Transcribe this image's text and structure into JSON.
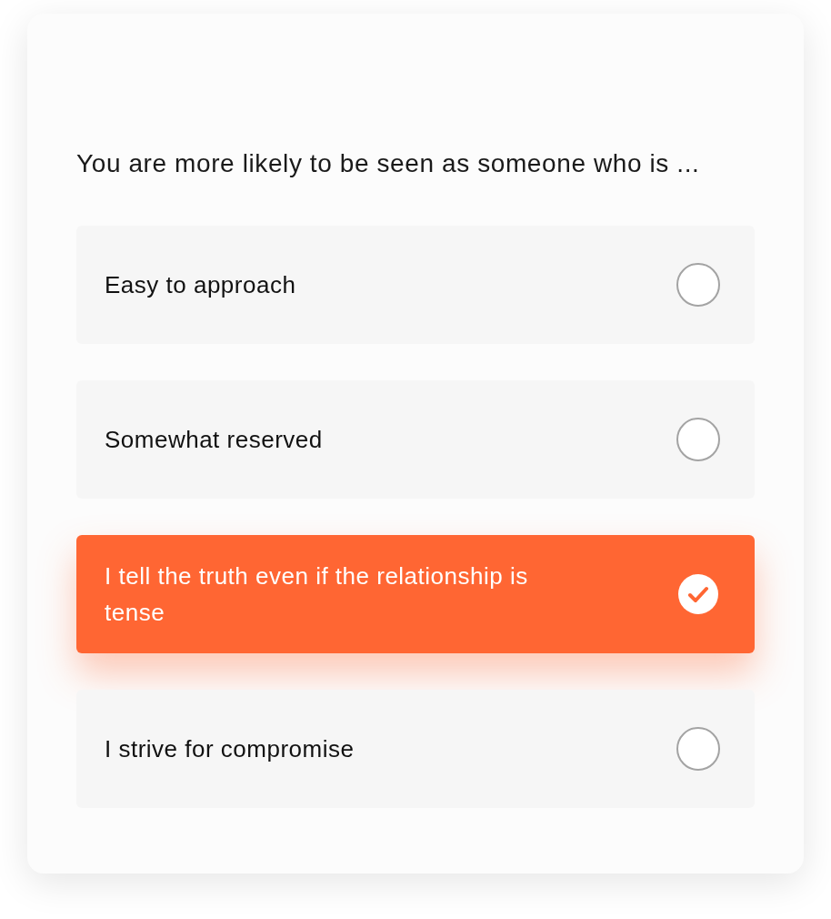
{
  "question": "You are more likely to be seen as someone who is ...",
  "options": [
    {
      "label": "Easy to approach",
      "selected": false
    },
    {
      "label": "Somewhat reserved",
      "selected": false
    },
    {
      "label": "I tell the truth even if the relationship is tense",
      "selected": true
    },
    {
      "label": "I strive for compromise",
      "selected": false
    }
  ]
}
